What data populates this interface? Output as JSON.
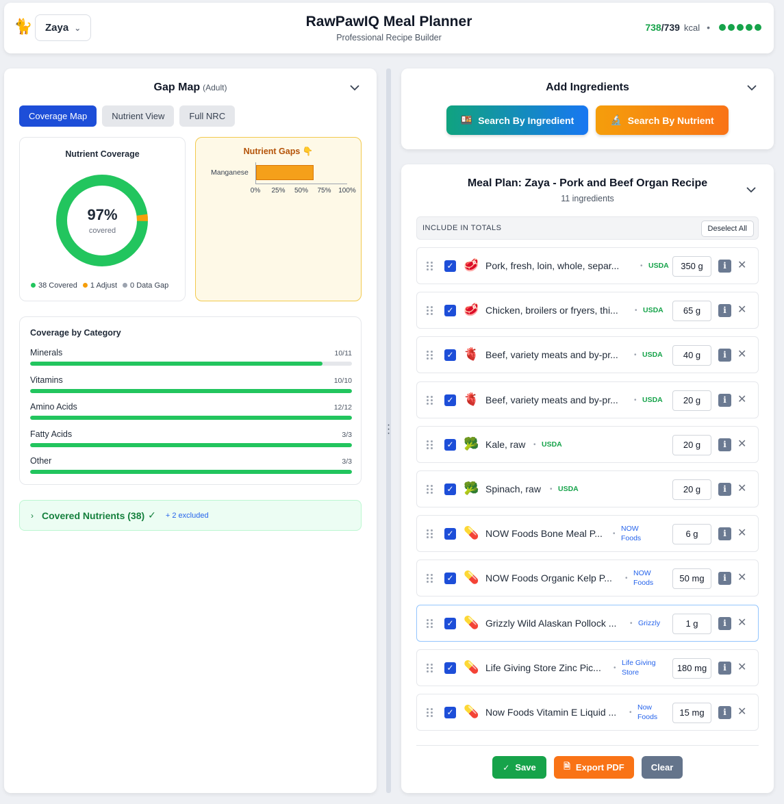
{
  "header": {
    "pet_emoji": "🐈",
    "pet_name": "Zaya",
    "title": "RawPawIQ Meal Planner",
    "subtitle": "Professional Recipe Builder",
    "kcal_current": "738",
    "kcal_total": "/739",
    "kcal_unit": "kcal",
    "status_dots": 5
  },
  "gap_map": {
    "title": "Gap Map",
    "life_stage": "(Adult)",
    "tabs": [
      "Coverage Map",
      "Nutrient View",
      "Full NRC"
    ],
    "active_tab": 0,
    "coverage": {
      "title": "Nutrient Coverage",
      "percent": "97%",
      "percent_label": "covered",
      "legend": [
        {
          "label": "38 Covered",
          "color": "#22c55e"
        },
        {
          "label": "1 Adjust",
          "color": "#f59e0b"
        },
        {
          "label": "0 Data Gap",
          "color": "#9ca3af"
        }
      ]
    },
    "gaps": {
      "title": "Nutrient Gaps 👇",
      "nutrient": "Manganese",
      "value_pct": 63,
      "ticks": [
        "0%",
        "25%",
        "50%",
        "75%",
        "100%"
      ]
    },
    "categories": {
      "title": "Coverage by Category",
      "items": [
        {
          "name": "Minerals",
          "count": "10/11",
          "fraction": 0.909
        },
        {
          "name": "Vitamins",
          "count": "10/10",
          "fraction": 1
        },
        {
          "name": "Amino Acids",
          "count": "12/12",
          "fraction": 1
        },
        {
          "name": "Fatty Acids",
          "count": "3/3",
          "fraction": 1
        },
        {
          "name": "Other",
          "count": "3/3",
          "fraction": 1
        }
      ]
    },
    "covered_nutrients": {
      "label": "Covered Nutrients (38)",
      "check": "✓",
      "excluded": "+ 2 excluded"
    }
  },
  "add_ingredients": {
    "title": "Add Ingredients",
    "search_ingredient": "Search By Ingredient",
    "search_nutrient": "Search By Nutrient",
    "ingredient_icon": "🍱",
    "nutrient_icon": "🔬"
  },
  "meal_plan": {
    "title": "Meal Plan: Zaya - Pork and Beef Organ Recipe",
    "count": "11 ingredients",
    "include_label": "INCLUDE IN TOTALS",
    "deselect_label": "Deselect All",
    "items": [
      {
        "emoji": "🥩",
        "name": "Pork, fresh, loin, whole, separ...",
        "source": "USDA",
        "qty": "350 g"
      },
      {
        "emoji": "🥩",
        "name": "Chicken, broilers or fryers, thi...",
        "source": "USDA",
        "qty": "65 g"
      },
      {
        "emoji": "🫀",
        "name": "Beef, variety meats and by-pr...",
        "source": "USDA",
        "qty": "40 g"
      },
      {
        "emoji": "🫀",
        "name": "Beef, variety meats and by-pr...",
        "source": "USDA",
        "qty": "20 g"
      },
      {
        "emoji": "🥦",
        "name": "Kale, raw",
        "source": "USDA",
        "qty": "20 g"
      },
      {
        "emoji": "🥦",
        "name": "Spinach, raw",
        "source": "USDA",
        "qty": "20 g"
      },
      {
        "emoji": "💊",
        "name": "NOW Foods Bone Meal P...",
        "source_lines": [
          "NOW",
          "Foods"
        ],
        "qty": "6 g"
      },
      {
        "emoji": "💊",
        "name": "NOW Foods Organic Kelp P...",
        "source_lines": [
          "NOW",
          "Foods"
        ],
        "qty": "50 mg"
      },
      {
        "emoji": "💊",
        "name": "Grizzly Wild Alaskan Pollock ...",
        "source": "Grizzly",
        "qty": "1 g"
      },
      {
        "emoji": "💊",
        "name": "Life Giving Store Zinc Pic...",
        "source_lines": [
          "Life Giving",
          "Store"
        ],
        "qty": "180 mg"
      },
      {
        "emoji": "💊",
        "name": "Now Foods Vitamin E Liquid ...",
        "source_lines": [
          "Now",
          "Foods"
        ],
        "qty": "15 mg"
      }
    ],
    "actions": {
      "save": "Save",
      "export": "Export PDF",
      "clear": "Clear"
    }
  }
}
